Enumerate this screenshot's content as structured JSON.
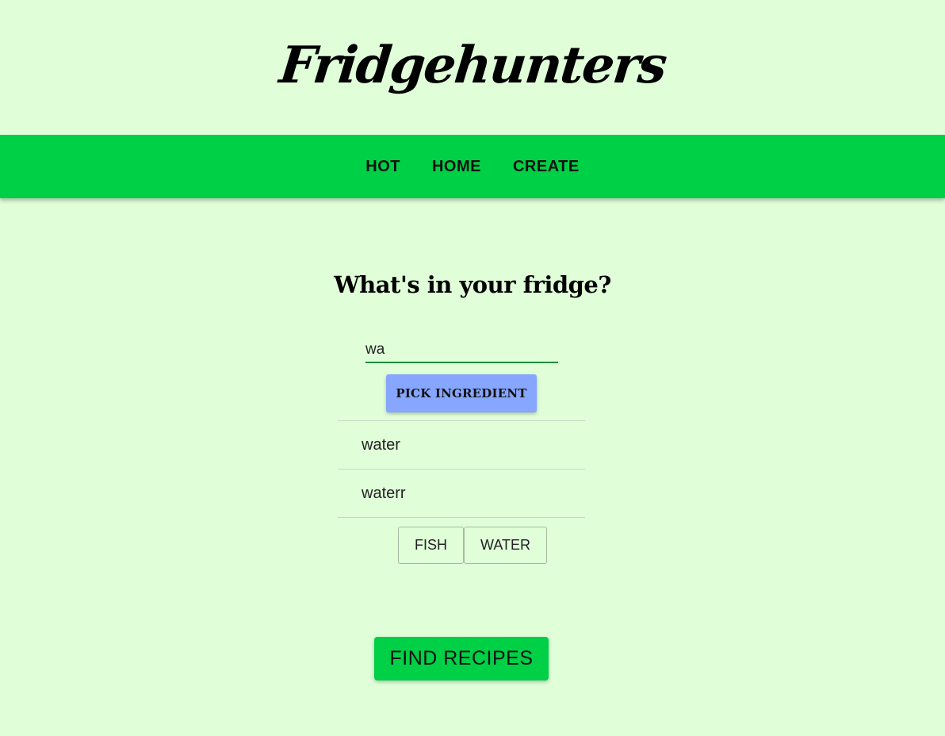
{
  "header": {
    "logo_text": "Fridgehunters"
  },
  "nav": {
    "items": [
      {
        "label": "HOT"
      },
      {
        "label": "HOME"
      },
      {
        "label": "CREATE"
      }
    ]
  },
  "main": {
    "prompt": "What's in your fridge?",
    "search": {
      "value": "wa",
      "placeholder": ""
    },
    "pick_button_label": "PICK INGREDIENT",
    "suggestions": [
      {
        "label": "water"
      },
      {
        "label": "waterr"
      }
    ],
    "selected_ingredients": [
      {
        "label": "FISH"
      },
      {
        "label": "WATER"
      }
    ],
    "find_button_label": "FIND RECIPES"
  },
  "colors": {
    "background": "#e0ffd9",
    "navbar": "#00d046",
    "pick_button": "#87a6ff",
    "input_underline": "#1c8a3f"
  }
}
